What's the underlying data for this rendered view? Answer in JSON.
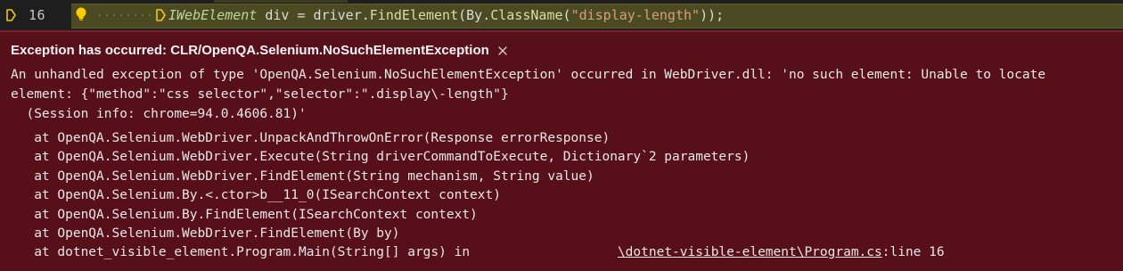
{
  "editor": {
    "line_number": "16",
    "code": {
      "type_name": "IWebElement",
      "after_type": " div = driver.",
      "method": "FindElement",
      "open_paren": "(By.",
      "class_name": "ClassName",
      "paren": "(",
      "string_literal": "\"display-length\"",
      "close": "));"
    },
    "icons": {
      "gutter": "execution-pointer-icon",
      "bulb": "lightbulb-icon",
      "statement": "current-statement-icon"
    },
    "colors": {
      "current_line": "#4c4a22",
      "pointer": "#f0c419",
      "bulb": "#ffcc00"
    }
  },
  "exception": {
    "title": "Exception has occurred: CLR/OpenQA.Selenium.NoSuchElementException",
    "close_icon": "close-icon",
    "message_lines": [
      "An unhandled exception of type 'OpenQA.Selenium.NoSuchElementException' occurred in WebDriver.dll: 'no such element: Unable to locate",
      "element: {\"method\":\"css selector\",\"selector\":\".display\\-length\"}",
      "  (Session info: chrome=94.0.4606.81)'"
    ],
    "stack": [
      "   at OpenQA.Selenium.WebDriver.UnpackAndThrowOnError(Response errorResponse)",
      "   at OpenQA.Selenium.WebDriver.Execute(String driverCommandToExecute, Dictionary`2 parameters)",
      "   at OpenQA.Selenium.WebDriver.FindElement(String mechanism, String value)",
      "   at OpenQA.Selenium.By.<.ctor>b__11_0(ISearchContext context)",
      "   at OpenQA.Selenium.By.FindElement(ISearchContext context)",
      "   at OpenQA.Selenium.WebDriver.FindElement(By by)"
    ],
    "last_frame": {
      "prefix": "   at dotnet_visible_element.Program.Main(String[] args) in",
      "spacer": "                   ",
      "file_link": "\\dotnet-visible-element\\Program.cs",
      "suffix": ":line 16"
    },
    "colors": {
      "background": "#57101a",
      "text": "#e8e8e8"
    }
  }
}
